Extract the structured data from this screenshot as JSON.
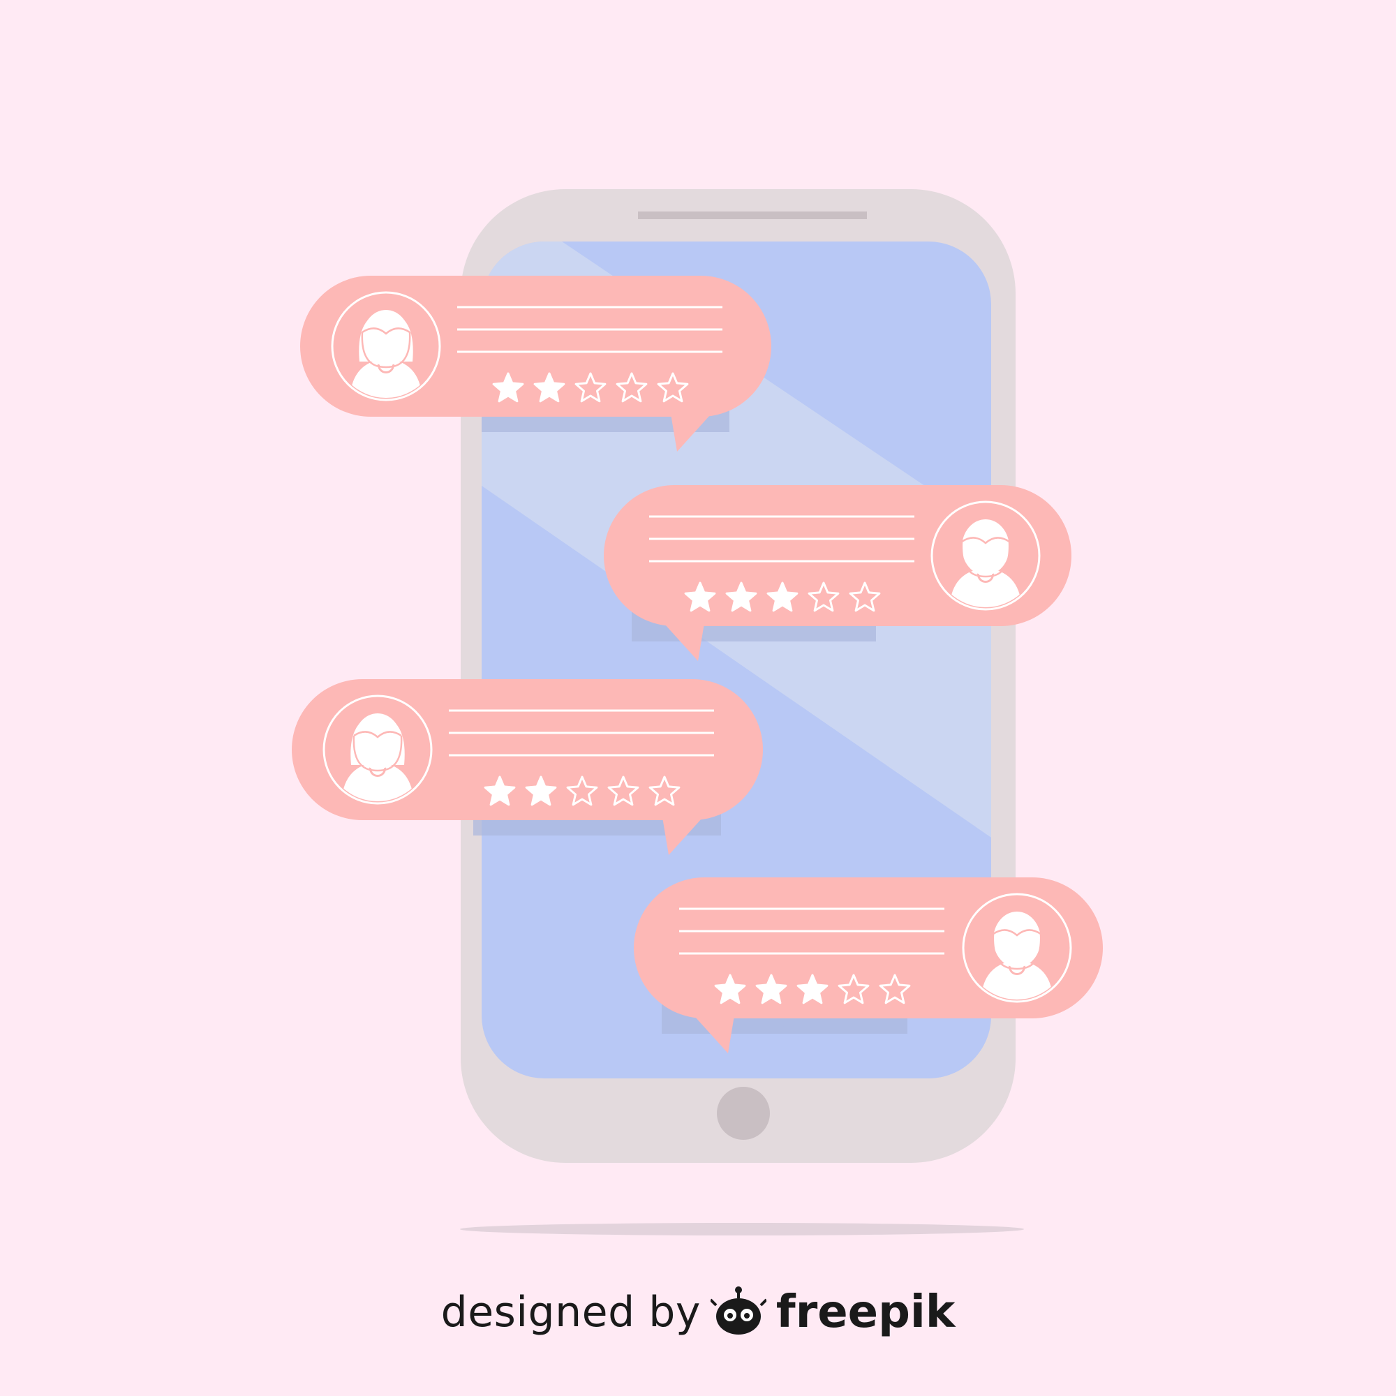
{
  "colors": {
    "background": "#ffeaf4",
    "phone_body": "#e3dadd",
    "phone_screen": "#b8c8f5",
    "screen_stripe": "#cbd6f2",
    "bubble": "#fdb8b6",
    "bubble_shadow": "#a9b6dd",
    "icon_fill": "#ffffff",
    "home_button": "#c9bfc3",
    "speaker": "#c9bfc3",
    "floor_shadow": "#e3d3dc"
  },
  "phone": {
    "screen_icon": "smartphone-icon",
    "button_icon": "home-button-icon"
  },
  "reviews": [
    {
      "avatar": "female-user-icon",
      "rating": 2,
      "max_rating": 5
    },
    {
      "avatar": "male-user-icon",
      "rating": 3,
      "max_rating": 5
    },
    {
      "avatar": "female-user-icon",
      "rating": 2,
      "max_rating": 5
    },
    {
      "avatar": "male-user-icon",
      "rating": 3,
      "max_rating": 5
    }
  ],
  "credit": {
    "prefix": "designed by",
    "brand": "freepik",
    "logo_icon": "freepik-logo-icon"
  }
}
